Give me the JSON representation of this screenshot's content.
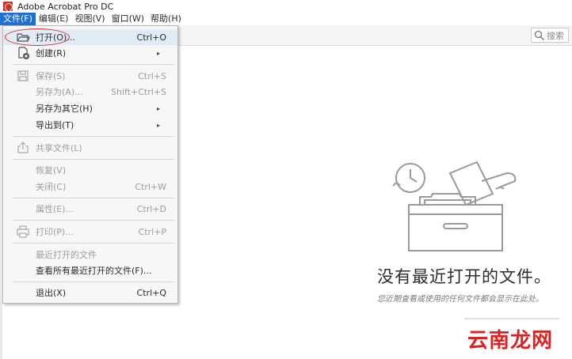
{
  "window": {
    "title": "Adobe Acrobat Pro DC"
  },
  "menubar": {
    "items": [
      {
        "label": "文件(F)",
        "active": true
      },
      {
        "label": "编辑(E)"
      },
      {
        "label": "视图(V)"
      },
      {
        "label": "窗口(W)"
      },
      {
        "label": "帮助(H)"
      }
    ]
  },
  "search": {
    "label": "搜索"
  },
  "file_menu": {
    "items": [
      {
        "label": "打开(O)...",
        "shortcut": "Ctrl+O",
        "icon": "folder-open-icon"
      },
      {
        "label": "创建(R)",
        "icon": "create-pdf-icon"
      },
      {
        "label": "保存(S)",
        "shortcut": "Ctrl+S",
        "icon": "save-icon"
      },
      {
        "label": "另存为(A)...",
        "shortcut": "Shift+Ctrl+S"
      },
      {
        "label": "另存为其它(H)"
      },
      {
        "label": "导出到(T)"
      },
      {
        "label": "共享文件(L)",
        "icon": "share-icon"
      },
      {
        "label": "恢复(V)"
      },
      {
        "label": "关闭(C)",
        "shortcut": "Ctrl+W"
      },
      {
        "label": "属性(E)...",
        "shortcut": "Ctrl+D"
      },
      {
        "label": "打印(P)...",
        "shortcut": "Ctrl+P",
        "icon": "print-icon"
      },
      {
        "label": "最近打开的文件"
      },
      {
        "label": "查看所有最近打开的文件(F)..."
      },
      {
        "label": "退出(X)",
        "shortcut": "Ctrl+Q"
      }
    ],
    "submenu_arrow": "▸"
  },
  "empty_state": {
    "title": "没有最近打开的文件。",
    "subtitle": "您近期查看或使用的任何文件都会显示在此处。"
  },
  "watermark": {
    "text": "云南龙网"
  },
  "colors": {
    "menu_active": "#1f6fd0",
    "highlight_circle": "#d42b2b",
    "acrobat_red": "#d12f1f"
  }
}
